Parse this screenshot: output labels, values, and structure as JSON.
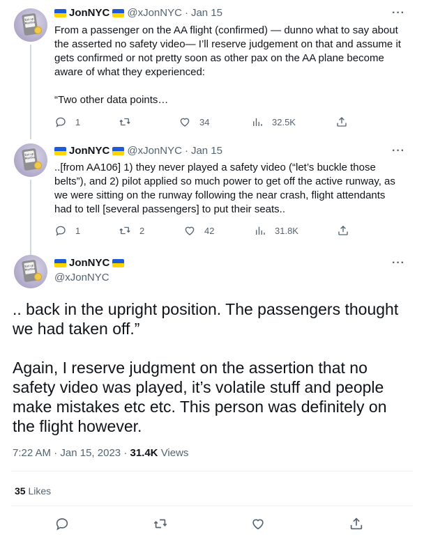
{
  "tweets": [
    {
      "name": "JonNYC",
      "handle": "@xJonNYC",
      "date": "Jan 15",
      "text_lines": [
        "From a passenger on the AA flight (confirmed) — dunno what to say about",
        "the asserted no safety video— I’ll reserve judgement on that and assume it",
        "gets confirmed or not pretty soon as other pax on the AA plane become",
        "aware of what they experienced:",
        "",
        "“Two other data points…"
      ],
      "replies": "1",
      "retweets": "",
      "likes": "34",
      "views": "32.5K"
    },
    {
      "name": "JonNYC",
      "handle": "@xJonNYC",
      "date": "Jan 15",
      "text_lines": [
        "..[from AA106] 1) they never played a safety video (“let’s buckle those",
        "belts”), and 2) pilot applied so much power to get off the active runway, as",
        "we were sitting on the runway following the near crash, flight attendants",
        "had to tell [several passengers] to put their seats.."
      ],
      "replies": "1",
      "retweets": "2",
      "likes": "42",
      "views": "31.8K"
    }
  ],
  "main_tweet": {
    "name": "JonNYC",
    "handle": "@xJonNYC",
    "text_lines": [
      ".. back in the upright position. The passengers thought",
      "we had taken off.”",
      "",
      "Again, I reserve judgment on the assertion that no",
      "safety video was played, it’s volatile stuff and people",
      "make mistakes etc etc. This person was definitely on",
      "the flight however."
    ],
    "time": "7:22 AM",
    "date": "Jan 15, 2023",
    "views_count": "31.4K",
    "views_label": "Views",
    "likes_count": "35",
    "likes_label": "Likes"
  },
  "avatar_text": "Eat up Martha",
  "more_label": "···",
  "separator": "·",
  "icons": [
    "reply-icon",
    "retweet-icon",
    "like-icon",
    "views-icon",
    "share-icon",
    "flag-icon",
    "more-icon"
  ],
  "colors": {
    "text": "#0f1419",
    "muted": "#536471",
    "thread": "#cfd9de",
    "flag_blue": "#1d5bd6",
    "flag_yellow": "#ffd500"
  }
}
